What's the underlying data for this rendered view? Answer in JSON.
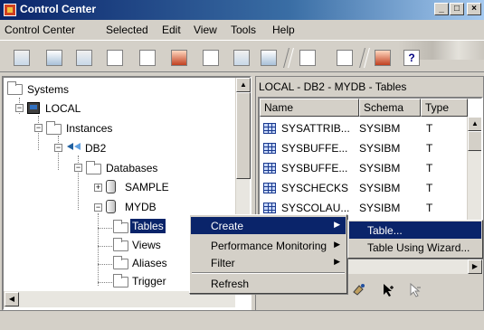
{
  "window": {
    "title": "Control Center",
    "minimize_glyph": "_",
    "maximize_glyph": "□",
    "close_glyph": "×"
  },
  "menubar": {
    "items": [
      "Control Center",
      "Selected",
      "Edit",
      "View",
      "Tools",
      "Help"
    ]
  },
  "toolbar": {
    "help_glyph": "?"
  },
  "tree": {
    "systems": "Systems",
    "local": "LOCAL",
    "instances": "Instances",
    "db2": "DB2",
    "databases": "Databases",
    "sample": "SAMPLE",
    "mydb": "MYDB",
    "tables": "Tables",
    "views": "Views",
    "aliases": "Aliases",
    "triggers": "Trigger",
    "plus": "+",
    "minus": "−"
  },
  "right_pane": {
    "title": "LOCAL - DB2 - MYDB - Tables",
    "columns": [
      "Name",
      "Schema",
      "Type"
    ],
    "rows": [
      {
        "name": "SYSATTRIB...",
        "schema": "SYSIBM",
        "type": "T"
      },
      {
        "name": "SYSBUFFE...",
        "schema": "SYSIBM",
        "type": "T"
      },
      {
        "name": "SYSBUFFE...",
        "schema": "SYSIBM",
        "type": "T"
      },
      {
        "name": "SYSCHECKS",
        "schema": "SYSIBM",
        "type": "T"
      },
      {
        "name": "SYSCOLAU...",
        "schema": "SYSIBM",
        "type": "T"
      }
    ]
  },
  "context_menu": {
    "items": [
      {
        "label": "Create",
        "arrow": "▶"
      },
      {
        "label": "Performance Monitoring",
        "arrow": "▶"
      },
      {
        "label": "Filter",
        "arrow": "▶"
      },
      {
        "label": "Refresh",
        "arrow": ""
      }
    ]
  },
  "create_submenu": {
    "items": [
      "Table...",
      "Table Using Wizard..."
    ]
  },
  "scroll_glyphs": {
    "up": "▲",
    "down": "▼",
    "left": "◀",
    "right": "▶"
  },
  "colors": {
    "highlight": "#0a246a",
    "title_gradient_start": "#0a246a",
    "face": "#d4d0c8"
  }
}
